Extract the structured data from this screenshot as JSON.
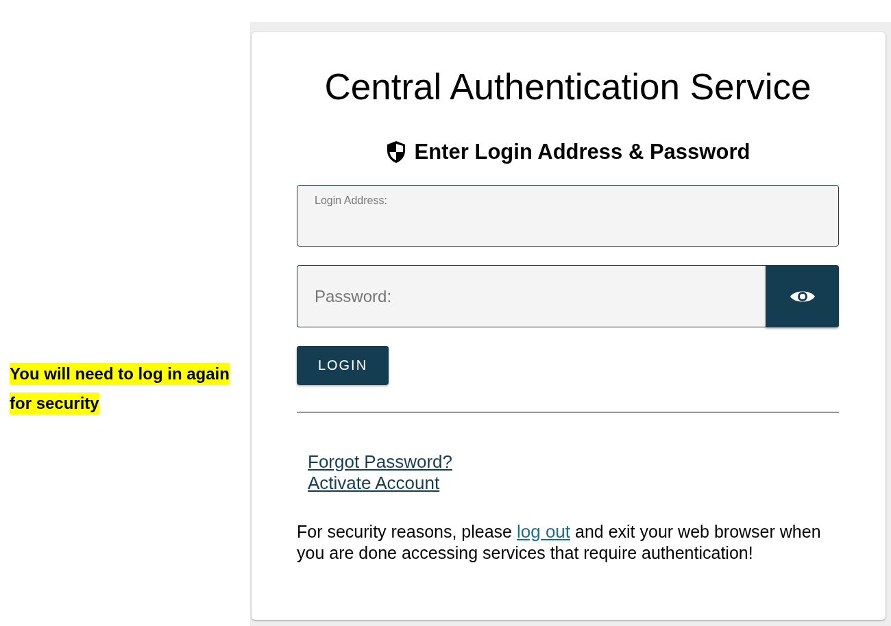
{
  "annotation": {
    "lines": [
      "You will need to log in again",
      "for security"
    ]
  },
  "card": {
    "title": "Central Authentication Service",
    "heading": "Enter Login Address & Password",
    "login_field": {
      "label": "Login Address:"
    },
    "password_field": {
      "placeholder": "Password:"
    },
    "login_button": "LOGIN",
    "links": [
      "Forgot Password?",
      "Activate Account"
    ],
    "notice": {
      "before": "For security reasons, please ",
      "link": "log out",
      "after": " and exit your web browser when you are done accessing services that require authentication!"
    }
  }
}
